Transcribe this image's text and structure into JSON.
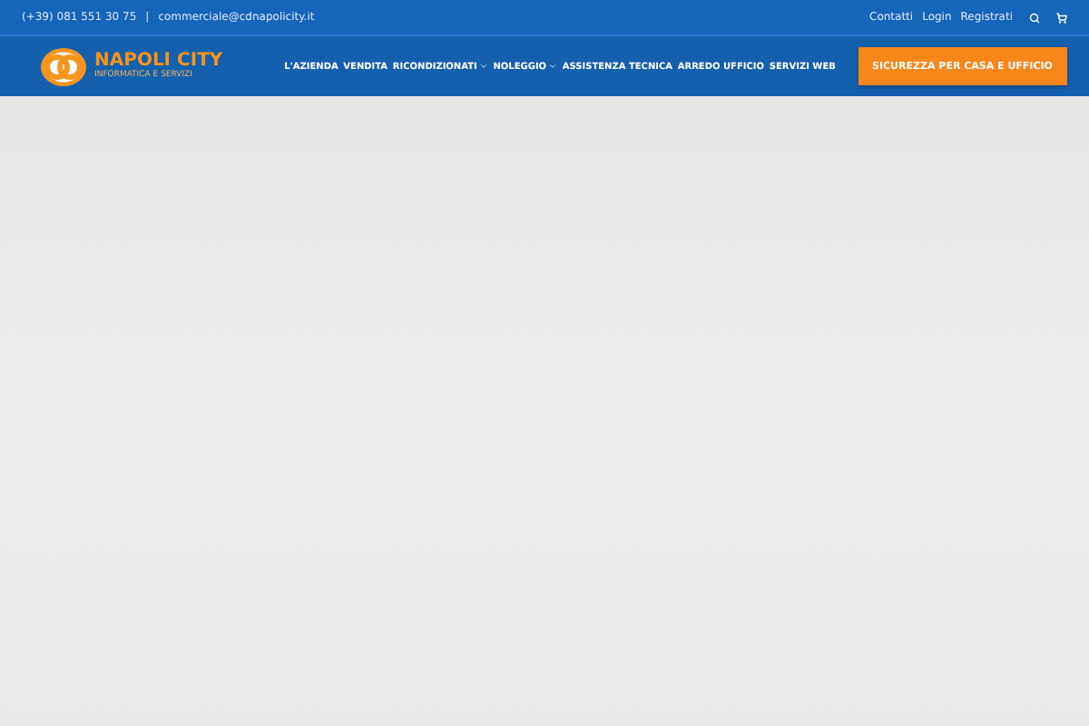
{
  "top_bar": {
    "phone": "(+39) 081 551 30 75",
    "separator": "|",
    "email": "commerciale@cdnapolicity.it",
    "links": [
      "Contatti",
      "Login",
      "Registrati"
    ]
  },
  "header": {
    "brand": "NAPOLI CITY",
    "tagline": "INFORMATICA E SERVIZI",
    "menu": [
      {
        "label": "L'AZIENDA",
        "has_submenu": false
      },
      {
        "label": "VENDITA",
        "has_submenu": false
      },
      {
        "label": "RICONDIZIONATI",
        "has_submenu": true
      },
      {
        "label": "NOLEGGIO",
        "has_submenu": true
      },
      {
        "label": "ASSISTENZA TECNICA",
        "has_submenu": false
      },
      {
        "label": "ARREDO UFFICIO",
        "has_submenu": false
      },
      {
        "label": "SERVIZI WEB",
        "has_submenu": false
      }
    ],
    "cta": "SICUREZZA PER CASA E UFFICIO"
  }
}
